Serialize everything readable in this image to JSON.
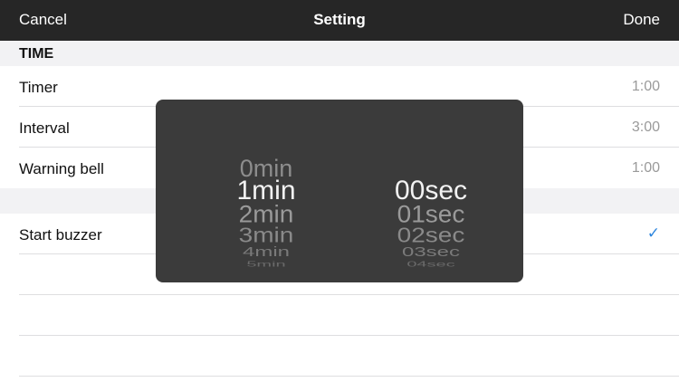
{
  "navbar": {
    "cancel": "Cancel",
    "title": "Setting",
    "done": "Done"
  },
  "section": {
    "title": "TIME"
  },
  "rows": [
    {
      "label": "Timer",
      "value": "1:00"
    },
    {
      "label": "Interval",
      "value": "3:00"
    },
    {
      "label": "Warning bell",
      "value": "1:00"
    }
  ],
  "start_buzzer": {
    "label": "Start buzzer",
    "icon": "checkmark-icon",
    "checked": true,
    "check_glyph": "✓"
  },
  "picker": {
    "minutes": [
      "0min",
      "1min",
      "2min",
      "3min",
      "4min",
      "5min"
    ],
    "seconds": [
      "00sec",
      "01sec",
      "02sec",
      "03sec",
      "04sec"
    ],
    "selected_minutes": "1min",
    "selected_seconds": "00sec"
  },
  "colors": {
    "navbar_bg": "#262626",
    "accent": "#2e86de",
    "picker_bg": "#3b3b3b"
  }
}
